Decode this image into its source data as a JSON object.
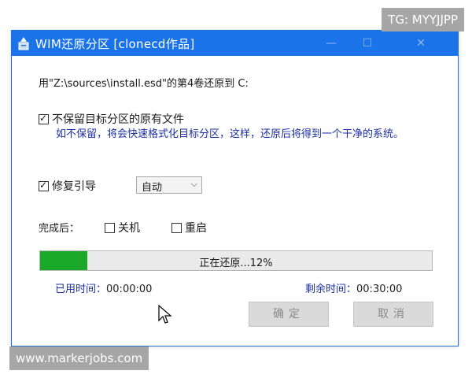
{
  "window": {
    "title": "WIM还原分区  [clonecd作品]",
    "controls": {
      "minimize": "—",
      "maximize": "☐",
      "close": "✕"
    }
  },
  "restore_line": "用\"Z:\\sources\\install.esd\"的第4卷还原到 C:",
  "options": {
    "keep_files_label": "不保留目标分区的原有文件",
    "keep_files_checked": true,
    "keep_files_info": "如不保留，将会快速格式化目标分区，这样，还原后将得到一个干净的系统。",
    "repair_boot_label": "修复引导",
    "repair_boot_checked": true,
    "repair_boot_mode": "自动"
  },
  "after_completion": {
    "label": "完成后：",
    "shutdown_label": "关机",
    "shutdown_checked": false,
    "restart_label": "重启",
    "restart_checked": false
  },
  "progress": {
    "text": "正在还原...12%",
    "fraction": 0.12,
    "fill_color": "#19a827"
  },
  "times": {
    "elapsed_label": "已用时间：",
    "elapsed_value": "00:00:00",
    "remaining_label": "剩余时间：",
    "remaining_value": "00:30:00"
  },
  "buttons": {
    "ok": "确定",
    "cancel": "取消"
  },
  "overlays": {
    "top_right": "TG: MYYJJPP",
    "bottom_left": "www.markerjobs.com"
  },
  "colors": {
    "titlebar": "#1a73e8",
    "info_text": "#1c2fa6"
  }
}
